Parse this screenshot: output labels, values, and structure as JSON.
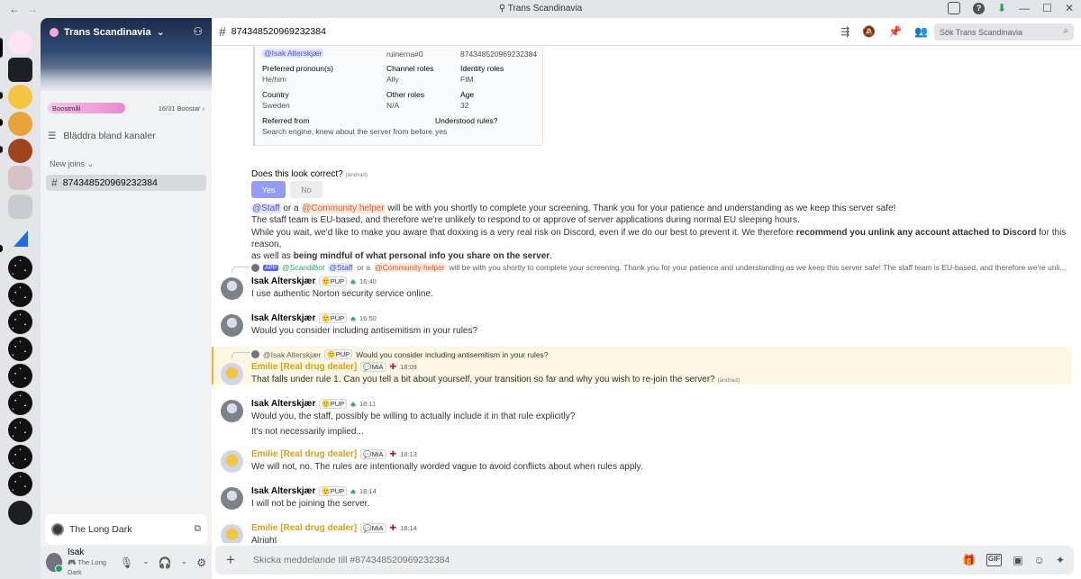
{
  "window": {
    "title": "Trans Scandinavia",
    "nav_back": "←",
    "nav_fwd": "→",
    "help": "?",
    "download": "⬇",
    "minimize": "—",
    "maximize": "☐",
    "close": "✕"
  },
  "server": {
    "name": "Trans Scandinavia",
    "invite_icon": "person-add-icon",
    "boost_label": "Boostmål",
    "boost_count": "16/31 Boostar",
    "boost_chevron": "›",
    "boost_progress": 0.52,
    "browse_label": "Bläddra bland kanaler",
    "category": "New joins",
    "category_chevron": "⌄",
    "channel": "874348520969232384"
  },
  "voice": {
    "activity": "The Long Dark"
  },
  "user": {
    "name": "Isak",
    "status": "The Long Dark"
  },
  "header": {
    "channel": "874348520969232384",
    "search_placeholder": "Sök Trans Scandinavia"
  },
  "form": {
    "user_mention": "@Isak Alterskjær",
    "username": "ruinerna#0",
    "user_id": "874348520969232384",
    "fields": [
      {
        "label": "Preferred pronoun(s)",
        "value": "He/him"
      },
      {
        "label": "Channel roles",
        "value": "Ally"
      },
      {
        "label": "Identity roles",
        "value": "FtM"
      },
      {
        "label": "Country",
        "value": "Sweden"
      },
      {
        "label": "Other roles",
        "value": "N/A"
      },
      {
        "label": "Age",
        "value": "32"
      },
      {
        "label": "Referred from",
        "value": "Search engine, knew about the server from before."
      },
      {
        "label": "Understood rules?",
        "value": "yes"
      }
    ]
  },
  "confirm": {
    "question": "Does this look correct?",
    "edited": "(ändrad)",
    "yes": "Yes",
    "no": "No"
  },
  "bot_message": {
    "staff": "@Staff",
    "or_a": " or a ",
    "helper": "@Community helper",
    "line1_rest": " will be with you shortly to complete your screening. Thank you for your patience and understanding as we keep this server safe!",
    "line2": "The staff team is EU-based, and therefore we're unlikely to respond to or approve of server applications during normal EU sleeping hours.",
    "line3_a": "While you wait, we'd like to make you aware that doxxing is a very real risk on Discord, even if we do our best to prevent it. We therefore ",
    "line3_b": "recommend you unlink any account attached to Discord",
    "line3_c": " for this reason,",
    "line4_a": "as well as ",
    "line4_b": "being mindful of what personal info you share on the server",
    "line4_c": "."
  },
  "reply_bot": {
    "app": "APP",
    "bot": "@ScandiBot",
    "staff": "@Staff",
    "or_a": "or a",
    "helper": "@Community helper",
    "rest": "will be with you shortly to complete your screening. Thank you for your patience and understanding as we keep this server safe! The staff team is EU-based, and therefore we're unli..."
  },
  "messages": [
    {
      "author": "Isak Alterskjær",
      "tag": "PUP",
      "time": "16:40",
      "text": "I use authentic Norton security service online."
    },
    {
      "author": "Isak Alterskjær",
      "tag": "PUP",
      "time": "16:50",
      "text": "Would you consider including antisemitism in your rules?"
    },
    {
      "author": "Emilie [Real drug dealer]",
      "tag": "MiA",
      "time": "18:09",
      "text": "That falls under rule 1. Can you tell a bit about yourself, your transition so far and why you wish to re-join the server?",
      "edited": "(ändrad)",
      "reply_author": "@Isak Alterskjær",
      "reply_tag": "PUP",
      "reply_text": "Would you consider including antisemitism in your rules?"
    },
    {
      "author": "Isak Alterskjær",
      "tag": "PUP",
      "time": "18:11",
      "text": "Would you, the staff, possibly be willing to actually include it in that rule explicitly?",
      "text2": "It's not necessarily implied..."
    },
    {
      "author": "Emilie [Real drug dealer]",
      "tag": "MiA",
      "time": "18:13",
      "text": "We will not, no. The rules are intentionally worded vague to avoid conflicts about when rules apply."
    },
    {
      "author": "Isak Alterskjær",
      "tag": "PUP",
      "time": "18:14",
      "text": "I will not be joining the server."
    },
    {
      "author": "Emilie [Real drug dealer]",
      "tag": "MiA",
      "time": "18:14",
      "text": "Alright"
    }
  ],
  "composer": {
    "placeholder": "Skicka meddelande till #874348520969232384"
  }
}
